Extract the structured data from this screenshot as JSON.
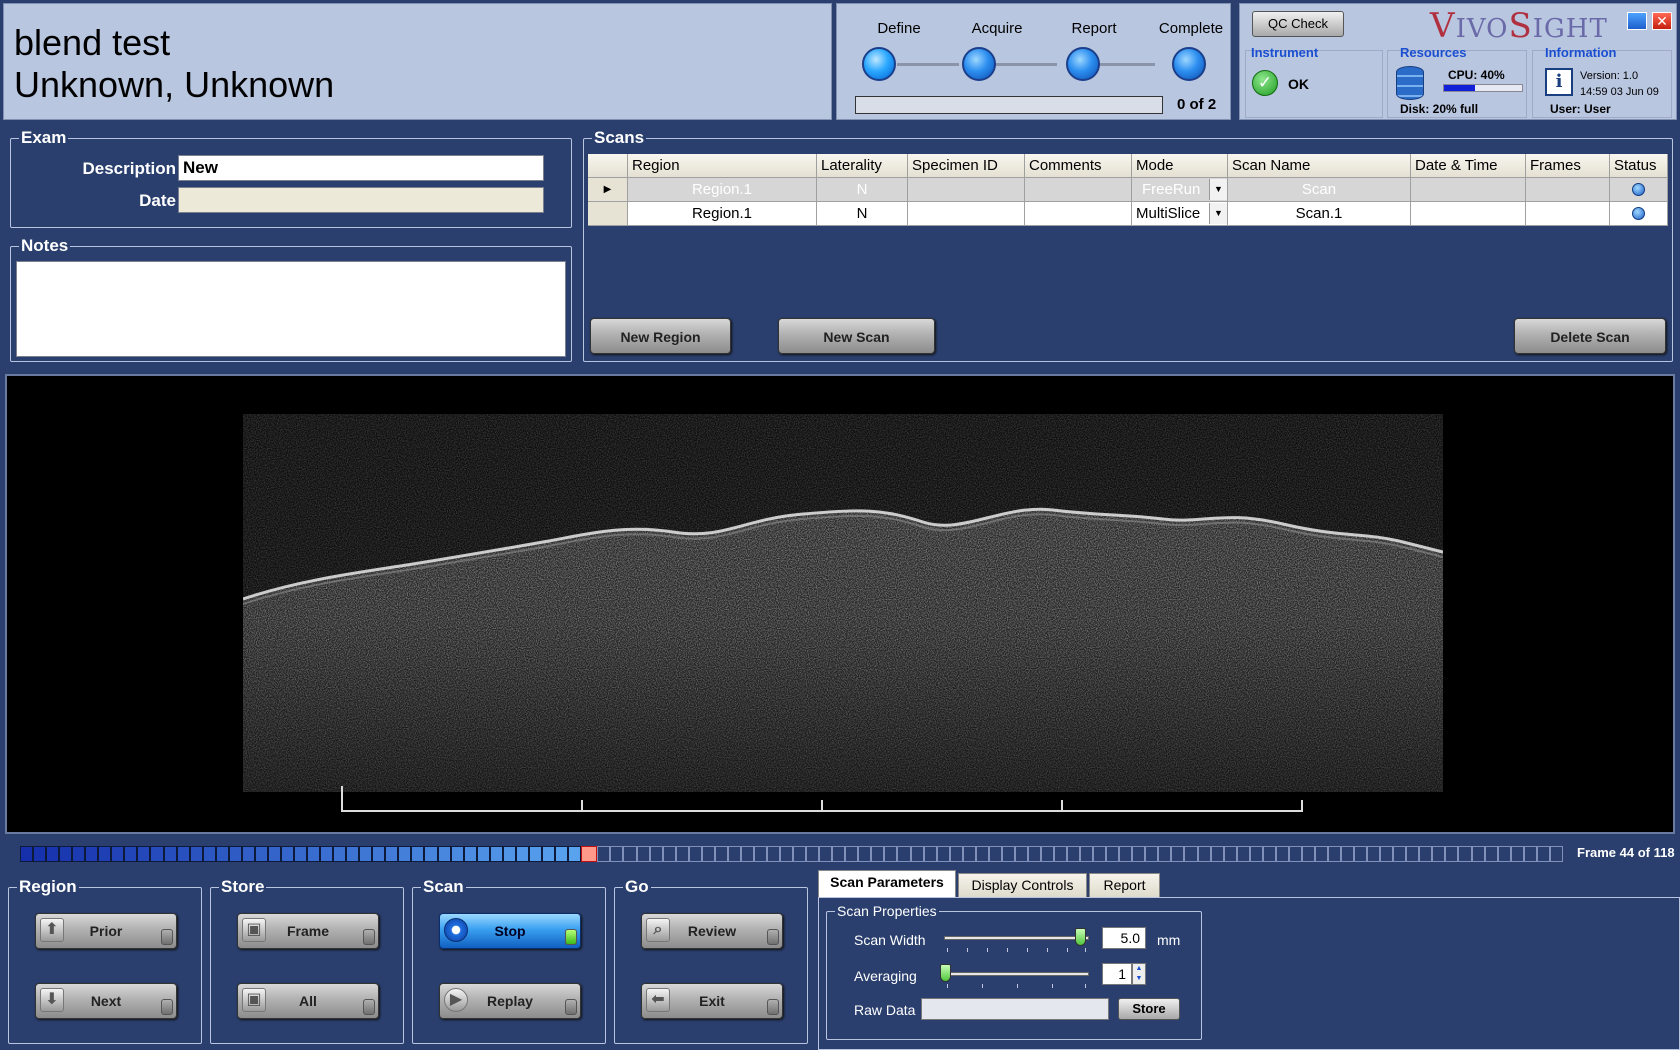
{
  "header": {
    "exam_name": "blend test",
    "patient_name": "Unknown, Unknown"
  },
  "workflow": {
    "steps": [
      {
        "label": "Define"
      },
      {
        "label": "Acquire"
      },
      {
        "label": "Report"
      },
      {
        "label": "Complete"
      }
    ],
    "progress_text": "0 of 2",
    "progress_fraction": 0
  },
  "app": {
    "qc_button": "QC Check",
    "logo_v": "V",
    "logo_ivo": "IVO",
    "logo_s": "S",
    "logo_ight": "IGHT",
    "close_glyph": "✕"
  },
  "instrument": {
    "heading": "Instrument",
    "status": "OK"
  },
  "resources": {
    "heading": "Resources",
    "cpu": "CPU: 40%",
    "cpu_fraction": 0.4,
    "disk": "Disk: 20% full"
  },
  "information": {
    "heading": "Information",
    "version": "Version: 1.0",
    "datetime": "14:59 03 Jun 09",
    "user": "User: User"
  },
  "exam": {
    "heading": "Exam",
    "description_label": "Description",
    "description_value": "New",
    "date_label": "Date",
    "date_value": ""
  },
  "notes": {
    "heading": "Notes",
    "value": ""
  },
  "scans": {
    "heading": "Scans",
    "columns": [
      "Region",
      "Laterality",
      "Specimen ID",
      "Comments",
      "Mode",
      "Scan Name",
      "Date & Time",
      "Frames",
      "Status"
    ],
    "rows": [
      {
        "region": "Region.1",
        "laterality": "N",
        "specimen_id": "",
        "comments": "",
        "mode": "FreeRun",
        "scan_name": "Scan",
        "date_time": "",
        "frames": ""
      },
      {
        "region": "Region.1",
        "laterality": "N",
        "specimen_id": "",
        "comments": "",
        "mode": "MultiSlice",
        "scan_name": "Scan.1",
        "date_time": "",
        "frames": ""
      }
    ],
    "new_region_button": "New Region",
    "new_scan_button": "New Scan",
    "delete_scan_button": "Delete Scan"
  },
  "frames": {
    "total": 118,
    "current": 44,
    "label": "Frame 44 of 118"
  },
  "controls": {
    "region": {
      "heading": "Region",
      "prior": "Prior",
      "next": "Next"
    },
    "store": {
      "heading": "Store",
      "frame": "Frame",
      "all": "All"
    },
    "scan": {
      "heading": "Scan",
      "stop": "Stop",
      "replay": "Replay"
    },
    "go": {
      "heading": "Go",
      "review": "Review",
      "exit": "Exit"
    }
  },
  "tabs": [
    {
      "label": "Scan Parameters"
    },
    {
      "label": "Display Controls"
    },
    {
      "label": "Report"
    }
  ],
  "scan_properties": {
    "heading": "Scan Properties",
    "scan_width_label": "Scan Width",
    "scan_width_value": "5.0",
    "scan_width_unit": "mm",
    "averaging_label": "Averaging",
    "averaging_value": "1",
    "raw_data_label": "Raw Data",
    "store_button": "Store"
  }
}
